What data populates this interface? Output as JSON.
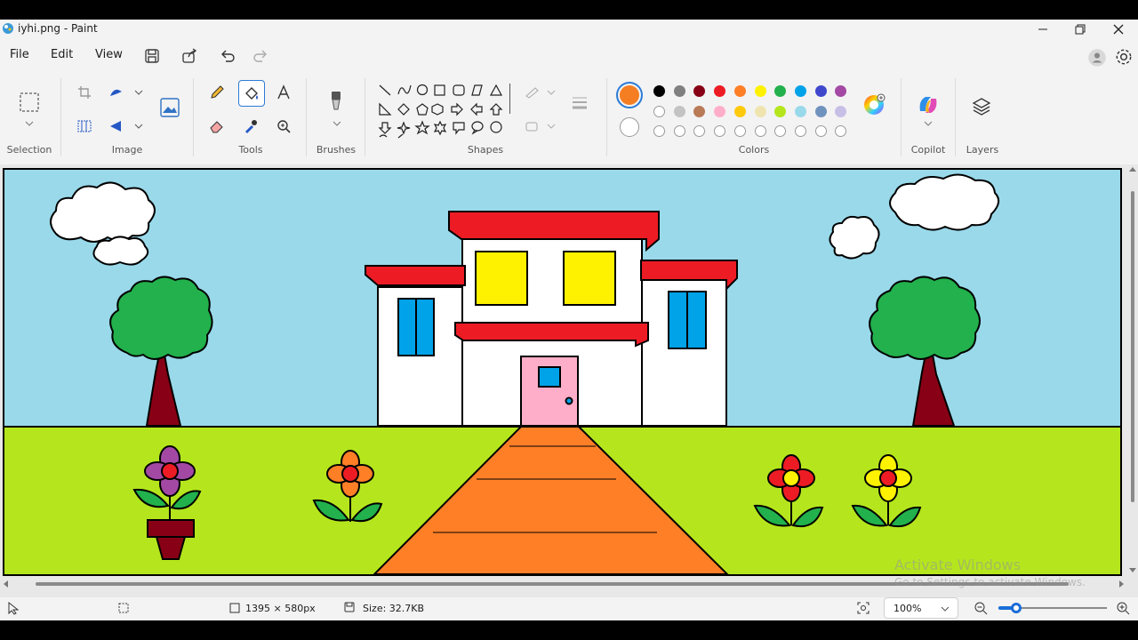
{
  "window": {
    "title": "iyhi.png - Paint"
  },
  "menu": {
    "file": "File",
    "edit": "Edit",
    "view": "View"
  },
  "ribbon": {
    "groups": {
      "selection": "Selection",
      "image": "Image",
      "tools": "Tools",
      "brushes": "Brushes",
      "shapes": "Shapes",
      "colors": "Colors",
      "copilot": "Copilot",
      "layers": "Layers"
    }
  },
  "colors": {
    "primary": "#f57e23",
    "secondary": "#ffffff",
    "row1": [
      "#000000",
      "#7f7f7f",
      "#880015",
      "#ed1c24",
      "#ff7f27",
      "#fff200",
      "#22b14c",
      "#00a2e8",
      "#3f48cc",
      "#a349a4"
    ],
    "row2": [
      "#ffffff",
      "#c3c3c3",
      "#b97a57",
      "#ffaec9",
      "#ffc90e",
      "#efe4b0",
      "#b5e61d",
      "#99d9ea",
      "#7092be",
      "#c8bfe7"
    ],
    "row3_count": 10
  },
  "status": {
    "dimensions": "1395 × 580px",
    "size": "Size: 32.7KB",
    "zoom": "100%",
    "zoom_level": 0.16
  },
  "watermark": {
    "line1": "Activate Windows",
    "line2": "Go to Settings to activate Windows."
  }
}
